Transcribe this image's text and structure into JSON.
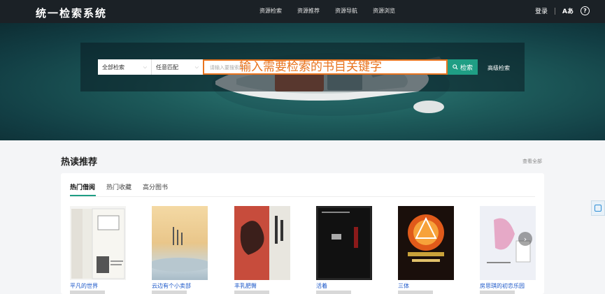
{
  "header": {
    "title": "统一检索系统",
    "nav": [
      "资源检索",
      "资源推荐",
      "资源导航",
      "资源浏览"
    ],
    "login": "登录",
    "translate_icon": "Aあ",
    "help_icon": "?"
  },
  "search": {
    "scope_select": "全部检索",
    "match_select": "任意匹配",
    "placeholder": "请输入要搜索的",
    "overlay_text": "输入需要检索的书目关键字",
    "search_button": "检索",
    "advanced": "高级检索"
  },
  "main": {
    "section_title": "热读推荐",
    "view_all": "查看全部",
    "tabs": [
      "热门借阅",
      "热门收藏",
      "高分图书"
    ],
    "books": [
      {
        "title": "平凡的世界",
        "icon": "book-cover"
      },
      {
        "title": "云边有个小卖部",
        "icon": "book-cover"
      },
      {
        "title": "丰乳肥臀",
        "icon": "book-cover"
      },
      {
        "title": "活着",
        "icon": "book-cover"
      },
      {
        "title": "三体",
        "icon": "book-cover"
      },
      {
        "title": "房思琪的初恋乐园",
        "icon": "book-cover"
      }
    ],
    "next_icon": "›"
  },
  "colors": {
    "accent": "#1f9e84",
    "annotation": "#e8741f",
    "topbar": "#1b2126",
    "link": "#1a56c8"
  }
}
